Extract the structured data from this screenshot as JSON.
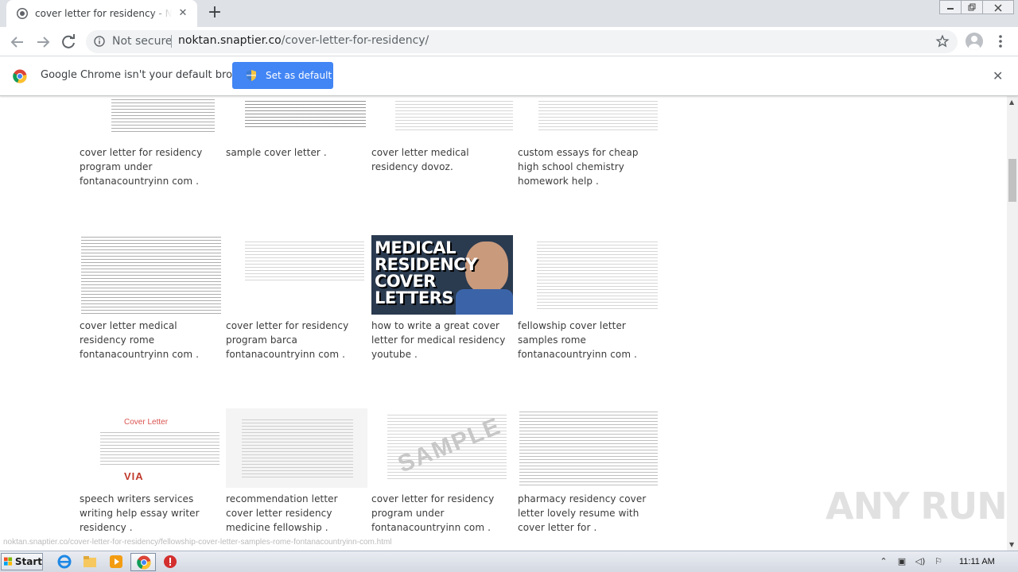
{
  "browser": {
    "tab_title": "cover letter for residency - Noktan.snaptier.co",
    "security_label": "Not secure",
    "url_host": "noktan.snaptier.co",
    "url_path": "/cover-letter-for-residency/"
  },
  "infobar": {
    "message": "Google Chrome isn't your default browser",
    "button_label": "Set as default"
  },
  "results": [
    {
      "caption": "cover letter for residency program under fontanacountryinn com ."
    },
    {
      "caption": "sample cover letter ."
    },
    {
      "caption": "cover letter medical residency dovoz."
    },
    {
      "caption": "custom essays for cheap high school chemistry homework help ."
    },
    {
      "caption": "cover letter medical residency rome fontanacountryinn com ."
    },
    {
      "caption": "cover letter for residency program barca fontanacountryinn com ."
    },
    {
      "caption": "how to write a great cover letter for medical residency youtube .",
      "thumb_text": "MEDICAL RESIDENCY COVER LETTERS"
    },
    {
      "caption": "fellowship cover letter samples rome fontanacountryinn com ."
    },
    {
      "caption": "speech writers services writing help essay writer residency .",
      "thumb_title": "Cover Letter",
      "thumb_brand": "VIA"
    },
    {
      "caption": "recommendation letter cover letter residency medicine fellowship ."
    },
    {
      "caption": "cover letter for residency program under fontanacountryinn com .",
      "thumb_watermark": "SAMPLE"
    },
    {
      "caption": "pharmacy residency cover letter lovely resume with cover letter for ."
    }
  ],
  "status_bar_url": "noktan.snaptier.co/cover-letter-for-residency/fellowship-cover-letter-samples-rome-fontanacountryinn-com.html",
  "watermark": "ANY RUN",
  "taskbar": {
    "start_label": "Start",
    "clock": "11:11 AM"
  },
  "colors": {
    "accent_button": "#4285f4",
    "tab_strip": "#dee1e6",
    "taskbar": "#d4d9e2"
  }
}
